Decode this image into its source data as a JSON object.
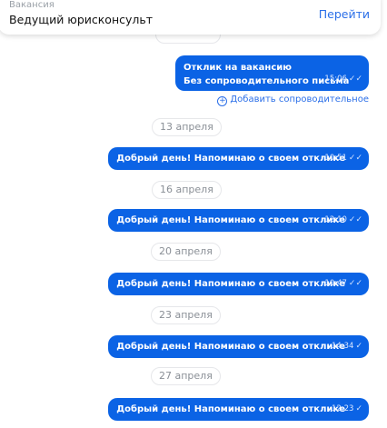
{
  "vacancy": {
    "label": "Вакансия",
    "title": "Ведущий юрисконсульт",
    "go_label": "Перейти"
  },
  "first_message": {
    "title": "Отклик на вакансию",
    "subtitle": "Без сопроводительного письма",
    "time": "15:06"
  },
  "add_cover_label": "Добавить сопроводительное",
  "dates": [
    "13 апреля",
    "16 апреля",
    "20 апреля",
    "23 апреля",
    "27 апреля"
  ],
  "messages": [
    {
      "text": "Добрый день! Напоминаю о своем отклике",
      "time": "10:51"
    },
    {
      "text": "Добрый день! Напоминаю о своем отклике",
      "time": "12:10"
    },
    {
      "text": "Добрый день! Напоминаю о своем отклике",
      "time": "10:47"
    },
    {
      "text": "Добрый день! Напоминаю о своем отклике",
      "time": "14:34"
    },
    {
      "text": "Добрый день! Напоминаю о своем отклике",
      "time": "12:23"
    }
  ],
  "colors": {
    "bubble": "#0b63e5",
    "link": "#2b6fe8",
    "pill_border": "#e6e7ea"
  },
  "icons": {
    "sent": "double-check-icon",
    "add": "plus-circle-icon"
  }
}
